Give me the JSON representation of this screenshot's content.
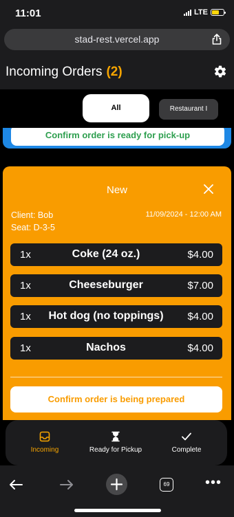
{
  "status_bar": {
    "time": "11:01",
    "network": "LTE"
  },
  "browser": {
    "url": "stad-rest.vercel.app",
    "tab_count": "69"
  },
  "header": {
    "title": "Incoming Orders",
    "count": "(2)"
  },
  "filters": {
    "all": "All",
    "restaurant": "Restaurant I"
  },
  "previous_order": {
    "action_label": "Confirm order is ready for pick-up"
  },
  "order": {
    "status": "New",
    "client": "Client: Bob",
    "seat": "Seat: D-3-5",
    "timestamp": "11/09/2024 - 12:00 AM",
    "items": [
      {
        "qty": "1x",
        "name": "Coke (24 oz.)",
        "price": "$4.00"
      },
      {
        "qty": "1x",
        "name": "Cheeseburger",
        "price": "$7.00"
      },
      {
        "qty": "1x",
        "name": "Hot dog (no toppings)",
        "price": "$4.00"
      },
      {
        "qty": "1x",
        "name": "Nachos",
        "price": "$4.00"
      }
    ],
    "action_label": "Confirm order is being prepared"
  },
  "tabs": [
    {
      "label": "Incoming",
      "icon": "inbox-icon"
    },
    {
      "label": "Ready for Pickup",
      "icon": "hourglass-icon"
    },
    {
      "label": "Complete",
      "icon": "checkmark-icon"
    }
  ],
  "colors": {
    "accent_orange": "#f99c00",
    "accent_blue": "#1e88e5",
    "green_text": "#2e9f4f"
  }
}
